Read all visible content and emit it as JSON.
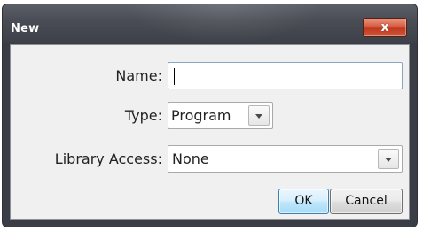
{
  "window": {
    "title": "New",
    "close_label": "x"
  },
  "form": {
    "name": {
      "label": "Name:",
      "value": ""
    },
    "type": {
      "label": "Type:",
      "value": "Program"
    },
    "library_access": {
      "label": "Library Access:",
      "value": "None"
    }
  },
  "buttons": {
    "ok_label": "OK",
    "cancel_label": "Cancel"
  },
  "icons": {
    "close": "close-icon",
    "dropdown": "chevron-down-icon"
  },
  "colors": {
    "title_bar": "#4a4d55",
    "close_button": "#c8452a",
    "dialog_body": "#f0f0f0",
    "ok_button": "#bee6fd",
    "focus_border": "#8aa5c4"
  }
}
